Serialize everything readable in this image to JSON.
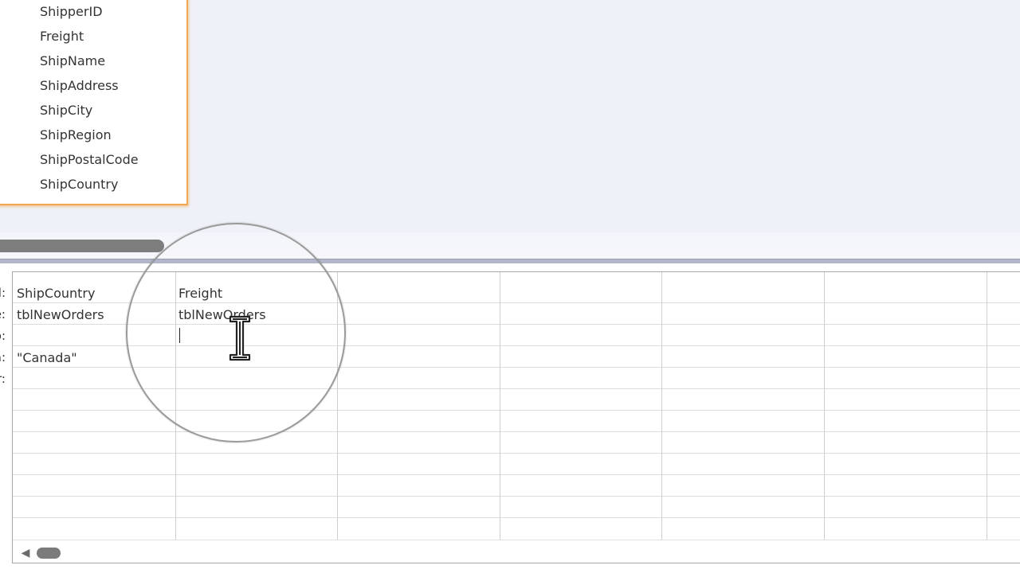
{
  "field_list": {
    "fields": [
      "ShipperID",
      "Freight",
      "ShipName",
      "ShipAddress",
      "ShipCity",
      "ShipRegion",
      "ShipPostalCode",
      "ShipCountry"
    ]
  },
  "qbe_grid": {
    "row_labels": [
      "d:",
      "e:",
      "o:",
      "a:",
      "r:"
    ],
    "columns": [
      {
        "field": "ShipCountry",
        "table": "tblNewOrders",
        "sort": "",
        "criteria": "\"Canada\""
      },
      {
        "field": "Freight",
        "table": "tblNewOrders",
        "sort": "",
        "criteria": ""
      }
    ]
  },
  "icons": {
    "scroll_left": "scroll-left-arrow-icon",
    "cursor": "ibeam-cursor-icon"
  },
  "colors": {
    "field_list_border": "#f0a850",
    "design_background": "#eff1f8",
    "splitter": "#b3b5c8",
    "scroll_thumb": "#7b7b7b",
    "highlight_ring": "#9a9a9a"
  }
}
